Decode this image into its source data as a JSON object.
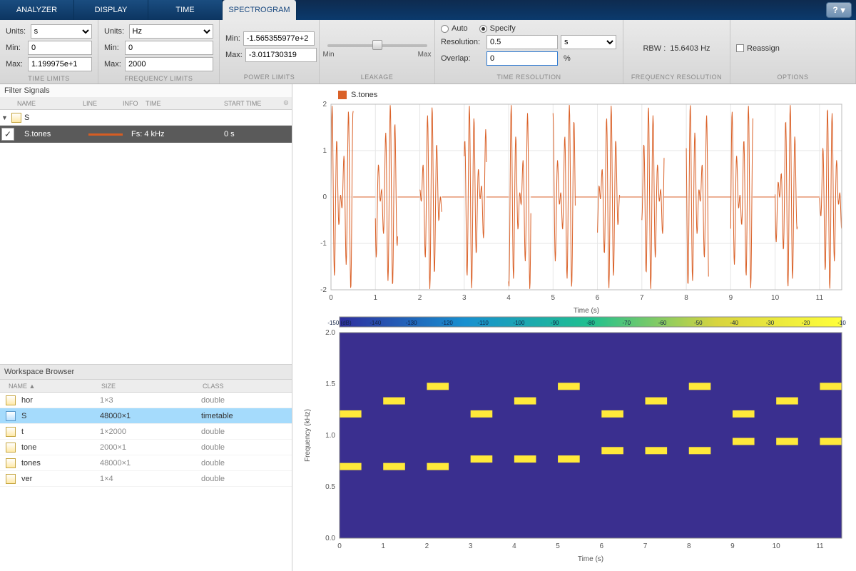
{
  "tabs": [
    "ANALYZER",
    "DISPLAY",
    "TIME",
    "SPECTROGRAM"
  ],
  "activeTab": 3,
  "help_icon": "?",
  "panels": {
    "timeLimits": {
      "title": "TIME LIMITS",
      "unitsLabel": "Units:",
      "units": "s",
      "minLabel": "Min:",
      "min": "0",
      "maxLabel": "Max:",
      "max": "1.199975e+1"
    },
    "freqLimits": {
      "title": "FREQUENCY LIMITS",
      "unitsLabel": "Units:",
      "units": "Hz",
      "minLabel": "Min:",
      "min": "0",
      "maxLabel": "Max:",
      "max": "2000"
    },
    "powerLimits": {
      "title": "POWER LIMITS",
      "minLabel": "Min:",
      "min": "-1.565355977e+2",
      "maxLabel": "Max:",
      "max": "-3.011730319"
    },
    "leakage": {
      "title": "LEAKAGE",
      "minLabel": "Min",
      "maxLabel": "Max"
    },
    "timeRes": {
      "title": "TIME RESOLUTION",
      "autoLabel": "Auto",
      "specifyLabel": "Specify",
      "specify": true,
      "resolutionLabel": "Resolution:",
      "resolution": "0.5",
      "resolutionUnits": "s",
      "overlapLabel": "Overlap:",
      "overlap": "0",
      "overlapUnits": "%"
    },
    "freqRes": {
      "title": "FREQUENCY RESOLUTION",
      "rbwLabel": "RBW :",
      "rbw": "15.6403 Hz"
    },
    "options": {
      "title": "OPTIONS",
      "reassignLabel": "Reassign"
    }
  },
  "filterSignals": {
    "title": "Filter Signals",
    "columns": [
      "NAME",
      "LINE",
      "INFO",
      "TIME",
      "START TIME"
    ],
    "group": "S",
    "signal": {
      "name": "S.tones",
      "info": "Fs: 4 kHz",
      "start": "0 s"
    }
  },
  "workspace": {
    "title": "Workspace Browser",
    "columns": [
      "NAME ▲",
      "SIZE",
      "CLASS"
    ],
    "rows": [
      {
        "name": "hor",
        "size": "1×3",
        "class": "double"
      },
      {
        "name": "S",
        "size": "48000×1",
        "class": "timetable",
        "selected": true,
        "isTT": true
      },
      {
        "name": "t",
        "size": "1×2000",
        "class": "double"
      },
      {
        "name": "tone",
        "size": "2000×1",
        "class": "double"
      },
      {
        "name": "tones",
        "size": "48000×1",
        "class": "double"
      },
      {
        "name": "ver",
        "size": "1×4",
        "class": "double"
      }
    ]
  },
  "chart_data": [
    {
      "type": "line",
      "title": "",
      "series_name": "S.tones",
      "xlabel": "Time (s)",
      "ylabel": "",
      "xlim": [
        0,
        11.5
      ],
      "ylim": [
        -2,
        2
      ],
      "xticks": [
        0,
        1,
        2,
        3,
        4,
        5,
        6,
        7,
        8,
        9,
        10,
        11
      ],
      "yticks": [
        -2,
        -1,
        0,
        1,
        2
      ],
      "note": "DTMF-like tone bursts of duration ~0.5s every 1s; amplitude ±2",
      "bursts": [
        {
          "t0": 0,
          "t1": 0.5
        },
        {
          "t0": 1,
          "t1": 1.5
        },
        {
          "t0": 2,
          "t1": 2.5
        },
        {
          "t0": 3,
          "t1": 3.5
        },
        {
          "t0": 4,
          "t1": 4.5
        },
        {
          "t0": 5,
          "t1": 5.5
        },
        {
          "t0": 6,
          "t1": 6.5
        },
        {
          "t0": 7,
          "t1": 7.5
        },
        {
          "t0": 8,
          "t1": 8.5
        },
        {
          "t0": 9,
          "t1": 9.5
        },
        {
          "t0": 10,
          "t1": 10.5
        },
        {
          "t0": 11,
          "t1": 11.5
        }
      ]
    },
    {
      "type": "heatmap",
      "title": "",
      "xlabel": "Time (s)",
      "ylabel": "Frequency (kHz)",
      "xlim": [
        0,
        11.5
      ],
      "ylim": [
        0,
        2.0
      ],
      "xticks": [
        0,
        1,
        2,
        3,
        4,
        5,
        6,
        7,
        8,
        9,
        10,
        11
      ],
      "yticks": [
        0,
        0.5,
        1.0,
        1.5,
        2.0
      ],
      "colorbar": {
        "label": "(dB)",
        "min": -150,
        "max": -10,
        "ticks": [
          -150,
          -140,
          -130,
          -120,
          -110,
          -100,
          -90,
          -80,
          -70,
          -60,
          -50,
          -40,
          -30,
          -20,
          -10
        ]
      },
      "segments": [
        {
          "t0": 0,
          "t1": 0.5,
          "low": 0.697,
          "high": 1.209
        },
        {
          "t0": 1,
          "t1": 1.5,
          "low": 0.697,
          "high": 1.336
        },
        {
          "t0": 2,
          "t1": 2.5,
          "low": 0.697,
          "high": 1.477
        },
        {
          "t0": 3,
          "t1": 3.5,
          "low": 0.77,
          "high": 1.209
        },
        {
          "t0": 4,
          "t1": 4.5,
          "low": 0.77,
          "high": 1.336
        },
        {
          "t0": 5,
          "t1": 5.5,
          "low": 0.77,
          "high": 1.477
        },
        {
          "t0": 6,
          "t1": 6.5,
          "low": 0.852,
          "high": 1.209
        },
        {
          "t0": 7,
          "t1": 7.5,
          "low": 0.852,
          "high": 1.336
        },
        {
          "t0": 8,
          "t1": 8.5,
          "low": 0.852,
          "high": 1.477
        },
        {
          "t0": 9,
          "t1": 9.5,
          "low": 0.941,
          "high": 1.209
        },
        {
          "t0": 10,
          "t1": 10.5,
          "low": 0.941,
          "high": 1.336
        },
        {
          "t0": 11,
          "t1": 11.5,
          "low": 0.941,
          "high": 1.477
        }
      ]
    }
  ]
}
